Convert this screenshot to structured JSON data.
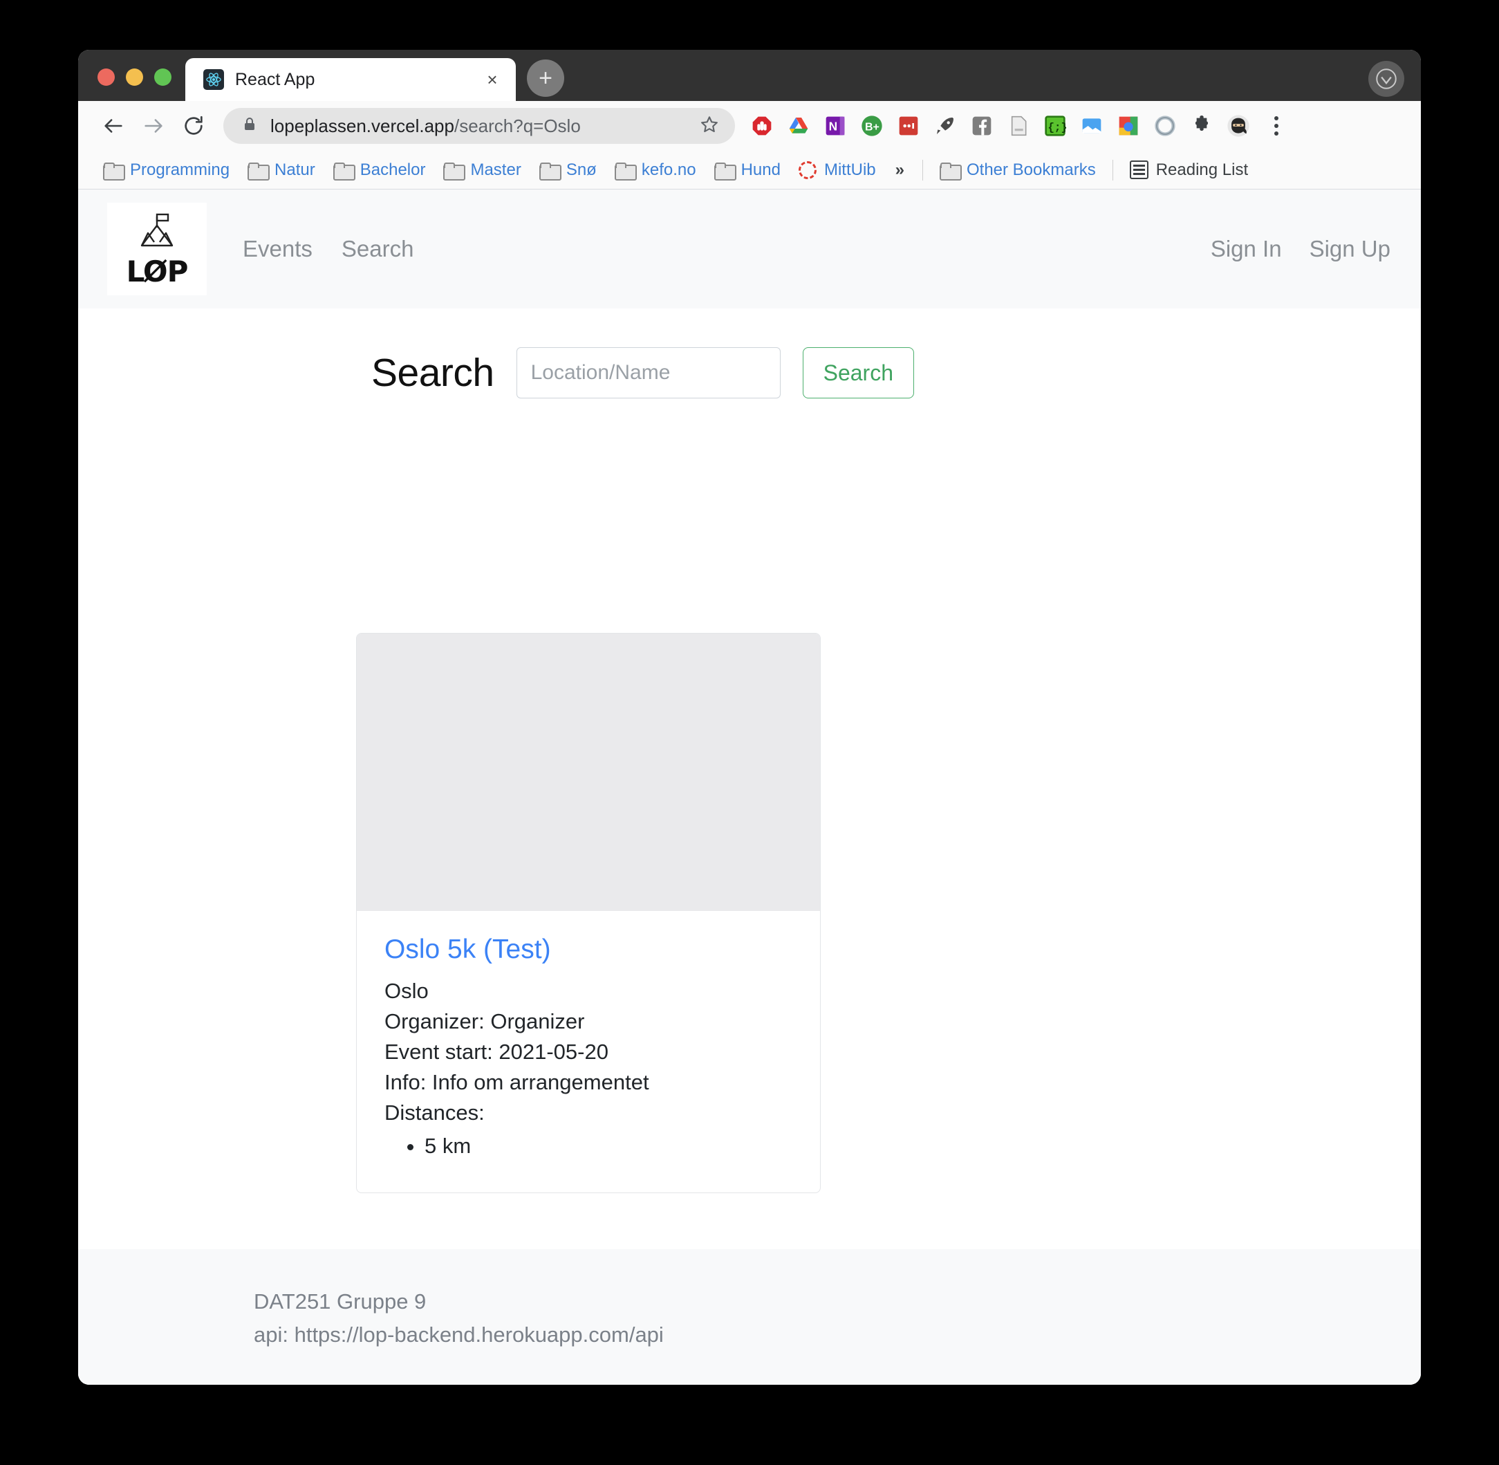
{
  "browser": {
    "tab": {
      "title": "React App",
      "favicon": "react-logo-icon",
      "close_label": "×"
    },
    "new_tab_label": "+",
    "toolbar": {
      "back_label": "←",
      "forward_label": "→",
      "reload_label": "⟳",
      "url_prefix": "lopeplassen.vercel.app",
      "url_suffix": "/search?q=Oslo",
      "lock_icon": "lock-icon",
      "star_icon": "star-icon",
      "extensions": [
        "adblock-icon",
        "google-drive-icon",
        "onenote-icon",
        "bitwarden-icon",
        "dotdotdot-icon",
        "rocket-icon",
        "facebook-icon",
        "document-icon",
        "code-brackets-icon",
        "image-icon",
        "google-colors-icon",
        "ring-icon",
        "puzzle-piece-icon"
      ],
      "avatar_icon": "ninja-avatar-icon",
      "menu_icon": "three-dot-menu-icon"
    },
    "bookmarks": [
      {
        "label": "Programming",
        "icon": "folder-icon"
      },
      {
        "label": "Natur",
        "icon": "folder-icon"
      },
      {
        "label": "Bachelor",
        "icon": "folder-icon"
      },
      {
        "label": "Master",
        "icon": "folder-icon"
      },
      {
        "label": "Snø",
        "icon": "folder-icon"
      },
      {
        "label": "kefo.no",
        "icon": "folder-icon"
      },
      {
        "label": "Hund",
        "icon": "folder-icon"
      },
      {
        "label": "MittUib",
        "icon": "dashed-circle-icon"
      }
    ],
    "bookmarks_overflow": "»",
    "other_bookmarks": {
      "label": "Other Bookmarks",
      "icon": "folder-icon"
    },
    "reading_list": {
      "label": "Reading List",
      "icon": "list-icon"
    }
  },
  "site": {
    "logo": {
      "word": "LØP",
      "icon": "mountain-flag-icon"
    },
    "nav": [
      {
        "label": "Events"
      },
      {
        "label": "Search"
      }
    ],
    "auth": [
      {
        "label": "Sign In"
      },
      {
        "label": "Sign Up"
      }
    ],
    "search": {
      "heading": "Search",
      "placeholder": "Location/Name",
      "value": "",
      "button_label": "Search",
      "button_color": "#3fa35f"
    },
    "results": [
      {
        "title": "Oslo 5k (Test)",
        "title_color": "#3b82f6",
        "location": "Oslo",
        "organizer": "Organizer: Organizer",
        "event_start": "Event start: 2021-05-20",
        "info": "Info: Info om arrangementet",
        "distances_label": "Distances:",
        "distances": [
          "5 km"
        ]
      }
    ],
    "footer": {
      "line1": "DAT251 Gruppe 9",
      "line2": "api: https://lop-backend.herokuapp.com/api"
    }
  }
}
